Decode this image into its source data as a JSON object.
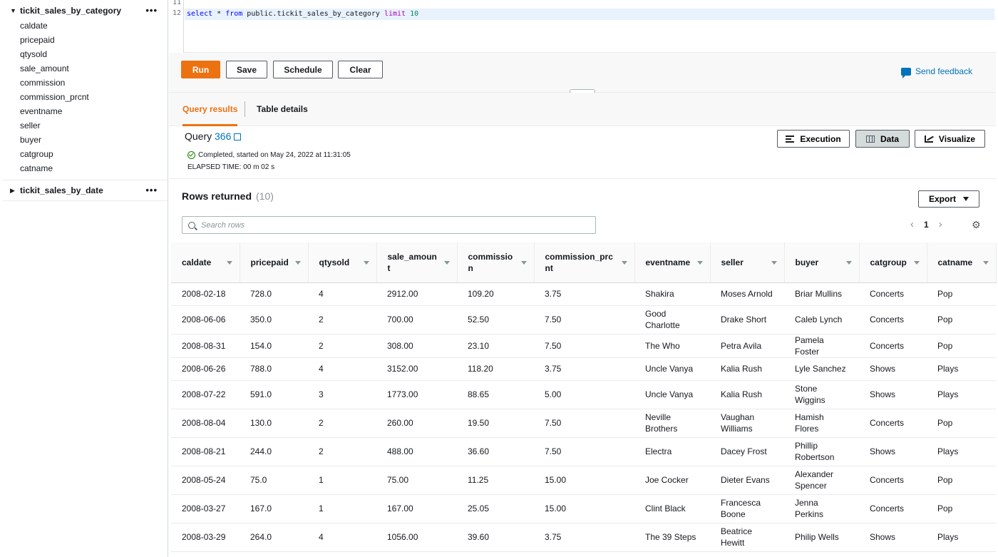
{
  "sidebar": {
    "tables": [
      {
        "name": "tickit_sales_by_category",
        "expanded": true,
        "columns": [
          "caldate",
          "pricepaid",
          "qtysold",
          "sale_amount",
          "commission",
          "commission_prcnt",
          "eventname",
          "seller",
          "buyer",
          "catgroup",
          "catname"
        ]
      },
      {
        "name": "tickit_sales_by_date",
        "expanded": false
      }
    ]
  },
  "editor": {
    "line_numbers": [
      "11",
      "12"
    ],
    "query_tokens": {
      "select": "select",
      "star": " * ",
      "from": "from",
      "table": " public.tickit_sales_by_category ",
      "limit": "limit",
      "n": " 10"
    }
  },
  "toolbar": {
    "run": "Run",
    "save": "Save",
    "schedule": "Schedule",
    "clear": "Clear",
    "feedback": "Send feedback"
  },
  "tabs": {
    "query_results": "Query results",
    "table_details": "Table details"
  },
  "query": {
    "label": "Query",
    "id": "366",
    "status": "Completed, started on May 24, 2022 at 11:31:05",
    "elapsed": "ELAPSED TIME: 00 m 02 s",
    "execution": "Execution",
    "data": "Data",
    "visualize": "Visualize"
  },
  "results": {
    "title": "Rows returned",
    "count": "(10)",
    "export": "Export",
    "search_placeholder": "Search rows",
    "page": "1"
  },
  "table": {
    "headers": [
      "caldate",
      "pricepaid",
      "qtysold",
      "sale_amount",
      "commission",
      "commission_prcnt",
      "eventname",
      "seller",
      "buyer",
      "catgroup",
      "catname"
    ],
    "rows": [
      [
        "2008-02-18",
        "728.0",
        "4",
        "2912.00",
        "109.20",
        "3.75",
        "Shakira",
        "Moses Arnold",
        "Briar Mullins",
        "Concerts",
        "Pop"
      ],
      [
        "2008-06-06",
        "350.0",
        "2",
        "700.00",
        "52.50",
        "7.50",
        "Good Charlotte",
        "Drake Short",
        "Caleb Lynch",
        "Concerts",
        "Pop"
      ],
      [
        "2008-08-31",
        "154.0",
        "2",
        "308.00",
        "23.10",
        "7.50",
        "The Who",
        "Petra Avila",
        "Pamela Foster",
        "Concerts",
        "Pop"
      ],
      [
        "2008-06-26",
        "788.0",
        "4",
        "3152.00",
        "118.20",
        "3.75",
        "Uncle Vanya",
        "Kalia Rush",
        "Lyle Sanchez",
        "Shows",
        "Plays"
      ],
      [
        "2008-07-22",
        "591.0",
        "3",
        "1773.00",
        "88.65",
        "5.00",
        "Uncle Vanya",
        "Kalia Rush",
        "Stone Wiggins",
        "Shows",
        "Plays"
      ],
      [
        "2008-08-04",
        "130.0",
        "2",
        "260.00",
        "19.50",
        "7.50",
        "Neville Brothers",
        "Vaughan Williams",
        "Hamish Flores",
        "Concerts",
        "Pop"
      ],
      [
        "2008-08-21",
        "244.0",
        "2",
        "488.00",
        "36.60",
        "7.50",
        "Electra",
        "Dacey Frost",
        "Phillip Robertson",
        "Shows",
        "Plays"
      ],
      [
        "2008-05-24",
        "75.0",
        "1",
        "75.00",
        "11.25",
        "15.00",
        "Joe Cocker",
        "Dieter Evans",
        "Alexander Spencer",
        "Concerts",
        "Pop"
      ],
      [
        "2008-03-27",
        "167.0",
        "1",
        "167.00",
        "25.05",
        "15.00",
        "Clint Black",
        "Francesca Boone",
        "Jenna Perkins",
        "Concerts",
        "Pop"
      ],
      [
        "2008-03-29",
        "264.0",
        "4",
        "1056.00",
        "39.60",
        "3.75",
        "The 39 Steps",
        "Beatrice Hewitt",
        "Philip Wells",
        "Shows",
        "Plays"
      ]
    ]
  },
  "colors": {
    "primary": "#ec7211",
    "link": "#0073bb",
    "success": "#1d8102"
  }
}
